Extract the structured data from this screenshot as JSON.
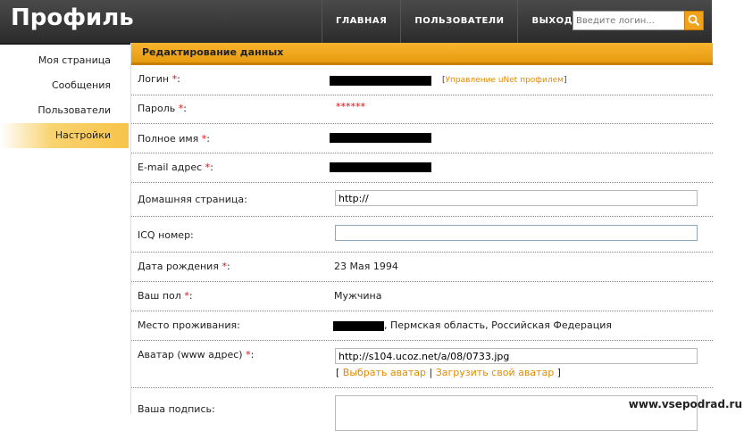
{
  "header": {
    "title": "Профиль",
    "nav": [
      "ГЛАВНАЯ",
      "ПОЛЬЗОВАТЕЛИ",
      "ВЫХОД"
    ],
    "search_placeholder": "Введите логин..."
  },
  "sidebar": {
    "items": [
      {
        "label": "Моя страница"
      },
      {
        "label": "Сообщения"
      },
      {
        "label": "Пользователи"
      },
      {
        "label": "Настройки",
        "active": true
      }
    ]
  },
  "section": {
    "title": "Редактирование данных"
  },
  "form": {
    "login_label": "Логин ",
    "unet_link": "Управление uNet профилем",
    "password_label": "Пароль ",
    "password_value": "******",
    "fullname_label": "Полное имя ",
    "email_label": "E-mail адрес ",
    "homepage_label": "Домашняя страница:",
    "homepage_value": "http://",
    "icq_label": "ICQ номер:",
    "icq_value": "",
    "birthdate_label": "Дата рождения ",
    "birthdate_value": "23 Мая 1994",
    "gender_label": "Ваш пол ",
    "gender_value": "Мужчина",
    "location_label": "Место проживания:",
    "location_value": ", Пермская область, Российская Федерация",
    "avatar_label": "Аватар (www адрес) ",
    "avatar_value": "http://s104.ucoz.net/a/08/0733.jpg",
    "choose_avatar": "Выбрать аватар",
    "upload_avatar": "Загрузить свой аватар",
    "signature_label": "Ваша подпись:"
  },
  "watermark": "www.vsepodrad.ru",
  "colors": {
    "accent": "#f0a21c",
    "required": "#e01010",
    "link": "#e28a00"
  }
}
